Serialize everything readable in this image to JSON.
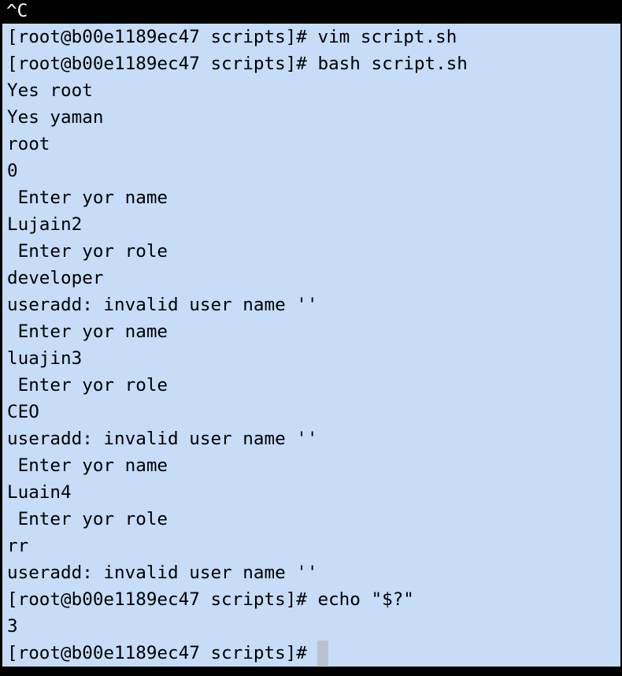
{
  "terminal": {
    "interrupt_line": "^C",
    "lines": [
      "[root@b00e1189ec47 scripts]# vim script.sh",
      "[root@b00e1189ec47 scripts]# bash script.sh",
      "Yes root",
      "Yes yaman",
      "root",
      "0",
      " Enter yor name",
      "Lujain2",
      " Enter yor role",
      "developer",
      "useradd: invalid user name ''",
      " Enter yor name",
      "luajin3",
      " Enter yor role",
      "CEO",
      "useradd: invalid user name ''",
      " Enter yor name",
      "Luain4",
      " Enter yor role",
      "rr",
      "useradd: invalid user name ''",
      "[root@b00e1189ec47 scripts]# echo \"$?\"",
      "3",
      "[root@b00e1189ec47 scripts]# "
    ],
    "colors": {
      "background": "#000000",
      "selection": "#c6dcf7",
      "selected_text": "#000000",
      "plain_text": "#ffffff",
      "cursor": "#b9c2cf"
    }
  }
}
